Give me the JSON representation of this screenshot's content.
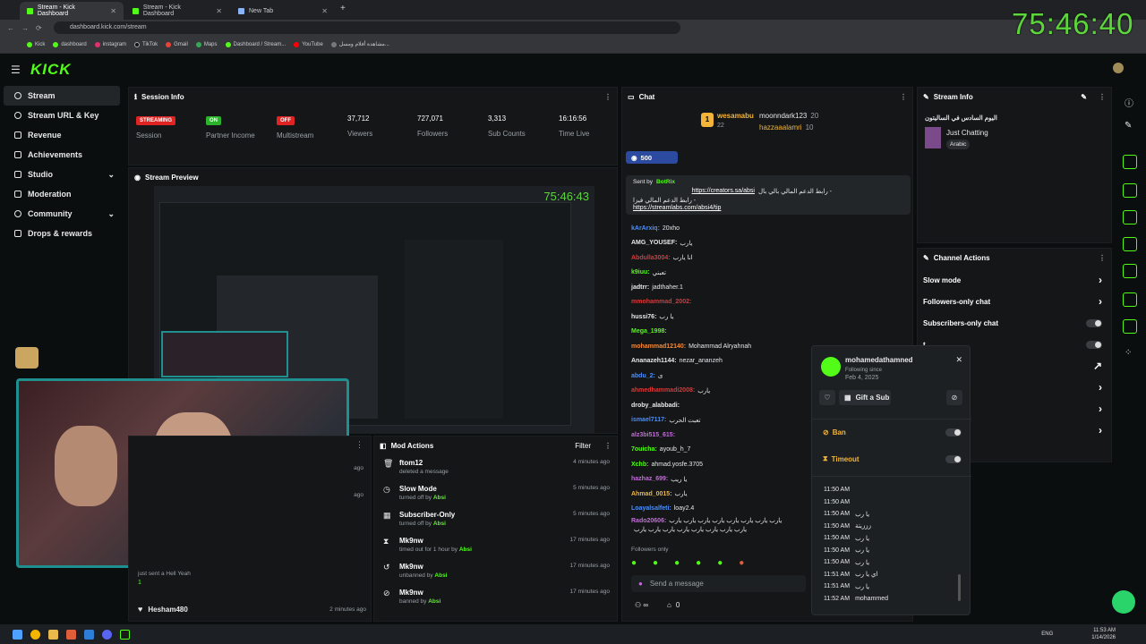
{
  "browser": {
    "tabs": [
      {
        "label": "Stream - Kick Dashboard"
      },
      {
        "label": "Stream - Kick Dashboard"
      },
      {
        "label": "New Tab"
      }
    ],
    "url": "dashboard.kick.com/stream",
    "bookmarks": [
      "Kick",
      "dashboard",
      "instagram",
      "TikTok",
      "Gmail",
      "Maps",
      "Dashboard / Stream...",
      "YouTube",
      "مشاهدة أفلام ومسل..."
    ]
  },
  "overlay_timer": "75:46:40",
  "kick": {
    "logo": "KICK"
  },
  "sidebar": {
    "items": [
      {
        "label": "Stream",
        "icon": "broadcast-icon",
        "active": true
      },
      {
        "label": "Stream URL & Key",
        "icon": "link-icon"
      },
      {
        "label": "Revenue",
        "icon": "wallet-icon"
      },
      {
        "label": "Achievements",
        "icon": "trophy-icon"
      },
      {
        "label": "Studio",
        "icon": "monitor-icon",
        "chevron": "⌄"
      },
      {
        "label": "Moderation",
        "icon": "shield-icon"
      },
      {
        "label": "Community",
        "icon": "users-icon",
        "chevron": "⌄"
      },
      {
        "label": "Drops & rewards",
        "icon": "gift-icon"
      }
    ]
  },
  "session": {
    "title": "Session Info",
    "stats": [
      {
        "value": "STREAMING",
        "label": "Session",
        "badge": true,
        "color": "#e02424"
      },
      {
        "value": "ON",
        "label": "Partner Income",
        "badge": true,
        "color": "#2bb32b"
      },
      {
        "value": "OFF",
        "label": "Multistream",
        "badge": true,
        "color": "#e02424"
      },
      {
        "value": "37,712",
        "label": "Viewers"
      },
      {
        "value": "727,071",
        "label": "Followers"
      },
      {
        "value": "3,313",
        "label": "Sub Counts"
      },
      {
        "value": "16:16:56",
        "label": "Time Live"
      }
    ]
  },
  "preview": {
    "title": "Stream Preview",
    "inner_timer": "75:46:43"
  },
  "recent_events": [
    {
      "user": "Hell Yeah",
      "sub": "just sent a Hell Yeah",
      "count": "1",
      "time": ""
    },
    {
      "user": "Hesham480",
      "sub": "",
      "count": "",
      "time": "2 minutes ago"
    }
  ],
  "side_times": [
    "ago",
    "ago"
  ],
  "mod_actions": {
    "title": "Mod Actions",
    "filter": "Filter",
    "rows": [
      {
        "title": "ftom12",
        "sub_prefix": "deleted a message",
        "by": "",
        "time": "4 minutes ago",
        "icon": "trash-icon"
      },
      {
        "title": "Slow Mode",
        "sub_prefix": "turned off by",
        "by": "Absi",
        "time": "5 minutes ago",
        "icon": "clock-icon"
      },
      {
        "title": "Subscriber-Only",
        "sub_prefix": "turned off by",
        "by": "Absi",
        "time": "5 minutes ago",
        "icon": "gift-icon"
      },
      {
        "title": "Mk9nw",
        "sub_prefix": "timed out for 1 hour by",
        "by": "Absi",
        "time": "17 minutes ago",
        "icon": "hourglass-icon"
      },
      {
        "title": "Mk9nw",
        "sub_prefix": "unbanned by",
        "by": "Absi",
        "time": "17 minutes ago",
        "icon": "undo-icon"
      },
      {
        "title": "Mk9nw",
        "sub_prefix": "banned by",
        "by": "Absi",
        "time": "17 minutes ago",
        "icon": "ban-icon"
      }
    ]
  },
  "chat": {
    "title": "Chat",
    "gifter_top": {
      "rank": "1",
      "name": "wesamabu",
      "count": "22"
    },
    "gifters": [
      {
        "name": "moonndark123",
        "count": "20"
      },
      {
        "name": "hazzaaalamri",
        "count": "10"
      }
    ],
    "goal": "500",
    "pinned": {
      "sent_by": "Sent by",
      "bot": "BotRix",
      "text": "رابط الدعم المالي بالي بال -",
      "link1": "https://creators.sa/absi",
      "text2": "رابط الدعم المالي فيزا -",
      "link2": "https://streamlabs.com/absi4/tip"
    },
    "messages": [
      {
        "user": "kArArxiq:",
        "color": "#4e8ef7",
        "text": "20xho"
      },
      {
        "user": "AMG_YOUSEF:",
        "color": "#e6e8ea",
        "text": "يارب"
      },
      {
        "user": "Abdulla3004:",
        "color": "#d63a3a",
        "text": "انا يارب"
      },
      {
        "user": "k9iuu:",
        "color": "#53fc18",
        "text": "تعبني"
      },
      {
        "user": "jadtrr:",
        "color": "#e6e8ea",
        "text": "jadthaher.1"
      },
      {
        "user": "mmohammad_2002:",
        "color": "#d63a3a",
        "text": ""
      },
      {
        "user": "hussi76:",
        "color": "#e6e8ea",
        "text": "يا رب"
      },
      {
        "user": "Mega_1998:",
        "color": "#53fc18",
        "text": ""
      },
      {
        "user": "mohammad12140:",
        "color": "#f28b3a",
        "text": "Mohammad Alryahnah"
      },
      {
        "user": "Ananazeh1144:",
        "color": "#e6e8ea",
        "text": "nezar_ananzeh"
      },
      {
        "user": "abdu_2:",
        "color": "#4e8ef7",
        "text": "ى"
      },
      {
        "user": "ahmedhammadi2008:",
        "color": "#d63a3a",
        "text": "يارب"
      },
      {
        "user": "droby_alabbadi:",
        "color": "#e6e8ea",
        "text": ""
      },
      {
        "user": "ismael7117:",
        "color": "#4e8ef7",
        "text": "تعبت الحرب"
      },
      {
        "user": "alz3bi515_615:",
        "color": "#c46adb",
        "text": ""
      },
      {
        "user": "7ouicha:",
        "color": "#53fc18",
        "text": "ayoub_h_7"
      },
      {
        "user": "Xchb:",
        "color": "#53fc18",
        "text": "ahmad.yosfe.3705"
      },
      {
        "user": "hazhaz_699:",
        "color": "#c46adb",
        "text": "يا ريب"
      },
      {
        "user": "Ahmad_0015:",
        "color": "#f2b53a",
        "text": "يارب"
      },
      {
        "user": "Loayalsalfeti:",
        "color": "#4e8ef7",
        "text": "loay2.4"
      },
      {
        "user": "Rado20606:",
        "color": "#c46adb",
        "text": "يارب يارب يارب يارب يارب يارب يارب يارب"
      },
      {
        "user": "",
        "color": "#e6e8ea",
        "text": "يارب يارب يارب يارب يارب يارب يارب يارب"
      }
    ],
    "followers_only": "Followers only",
    "placeholder": "Send a message",
    "count": "0"
  },
  "user_card": {
    "name": "mohamedathamned",
    "following_since_label": "Following since",
    "following_since": "Feb 4, 2025",
    "gift_sub": "Gift a Sub",
    "ban": "Ban",
    "timeout": "Timeout",
    "history": [
      {
        "time": "11:50 AM",
        "text": ""
      },
      {
        "time": "11:50 AM",
        "text": ""
      },
      {
        "time": "11:50 AM",
        "text": "يا رب"
      },
      {
        "time": "11:50 AM",
        "text": "زززيتة"
      },
      {
        "time": "11:50 AM",
        "text": "يا رب"
      },
      {
        "time": "11:50 AM",
        "text": "يا رب"
      },
      {
        "time": "11:50 AM",
        "text": "يا رب"
      },
      {
        "time": "11:51 AM",
        "text": "اي يا رب"
      },
      {
        "time": "11:51 AM",
        "text": "يا رب"
      },
      {
        "time": "11:52 AM",
        "text": "mohammed"
      }
    ]
  },
  "stream_info": {
    "title": "Stream Info",
    "stream_title": "اليوم السادس في الساليتون",
    "category": "Just Chatting",
    "tag": "Arabic"
  },
  "channel_actions": {
    "title": "Channel Actions",
    "items": [
      {
        "label": "Slow mode",
        "control": "›"
      },
      {
        "label": "Followers-only chat",
        "control": "›"
      },
      {
        "label": "Subscribers-only chat",
        "control": "toggle"
      },
      {
        "label": "t",
        "control": "toggle"
      },
      {
        "label": "on",
        "control": "↗"
      },
      {
        "label": "riction",
        "control": "›"
      },
      {
        "label": "",
        "control": "›"
      },
      {
        "label": "",
        "control": "›"
      }
    ]
  },
  "taskbar": {
    "lang": "ENG",
    "time": "11:53 AM",
    "date": "1/14/2026"
  }
}
